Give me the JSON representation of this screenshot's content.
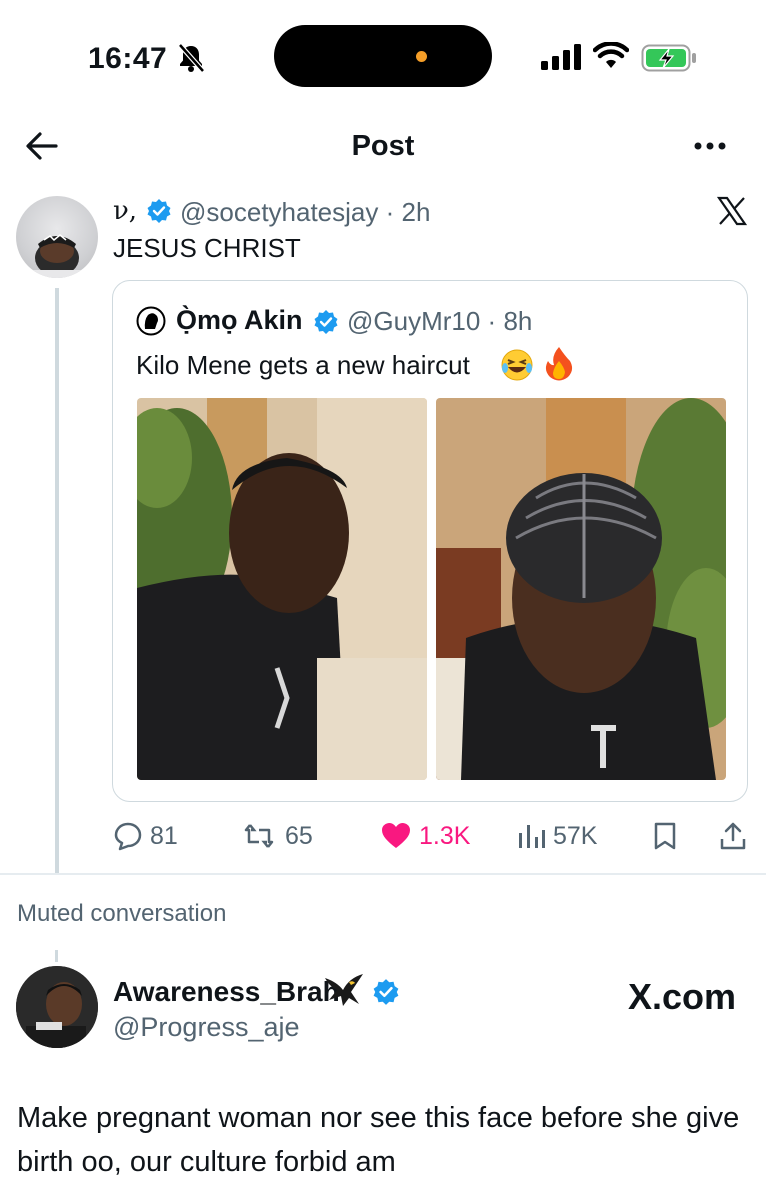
{
  "status_bar": {
    "time": "16:47",
    "island_dot_color": "#f59e28",
    "battery_color": "#34c759"
  },
  "nav": {
    "title": "Post",
    "back_icon": "arrow-left-icon",
    "more_icon": "more-icon"
  },
  "tweet": {
    "user_name": "ν,",
    "handle": "@socetyhatesjay",
    "time": "2h",
    "text": "JESUS CHRIST",
    "quote": {
      "name": "Ọ̀mọ Akin",
      "handle": "@GuyMr10",
      "time": "8h",
      "text": "Kilo Mene gets a new haircut",
      "emojis": [
        "laughing-emoji",
        "fire-emoji"
      ]
    },
    "actions": {
      "replies": "81",
      "reposts": "65",
      "likes": "1.3K",
      "views": "57K"
    }
  },
  "muted_label": "Muted conversation",
  "tweet2": {
    "name": "Awareness_Brah",
    "handle": "@Progress_aje",
    "text": "Make pregnant woman nor see this face before she give birth oo, our culture forbid am",
    "watermark": "X.com"
  },
  "colors": {
    "verified": "#1d9bf0",
    "like": "#f91880",
    "muted_text": "#536471"
  }
}
